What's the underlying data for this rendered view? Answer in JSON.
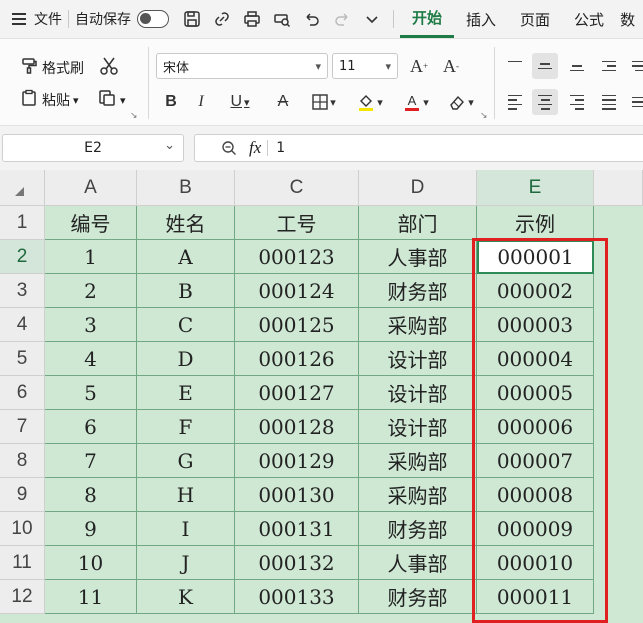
{
  "menubar": {
    "file_label": "文件",
    "autosave_label": "自动保存",
    "tabs": [
      "开始",
      "插入",
      "页面",
      "公式"
    ],
    "partial_tab": "数"
  },
  "ribbon": {
    "format_painter_label": "格式刷",
    "paste_label": "粘贴",
    "font_name": "宋体",
    "font_size": "11"
  },
  "formula_bar": {
    "cell_ref": "E2",
    "fx_label": "fx",
    "value": "1"
  },
  "sheet": {
    "columns": [
      "A",
      "B",
      "C",
      "D",
      "E"
    ],
    "rows": [
      "1",
      "2",
      "3",
      "4",
      "5",
      "6",
      "7",
      "8",
      "9",
      "10",
      "11",
      "12"
    ],
    "active_cell": "E2",
    "table": [
      [
        "编号",
        "姓名",
        "工号",
        "部门",
        "示例"
      ],
      [
        "1",
        "A",
        "000123",
        "人事部",
        "000001"
      ],
      [
        "2",
        "B",
        "000124",
        "财务部",
        "000002"
      ],
      [
        "3",
        "C",
        "000125",
        "采购部",
        "000003"
      ],
      [
        "4",
        "D",
        "000126",
        "设计部",
        "000004"
      ],
      [
        "5",
        "E",
        "000127",
        "设计部",
        "000005"
      ],
      [
        "6",
        "F",
        "000128",
        "设计部",
        "000006"
      ],
      [
        "7",
        "G",
        "000129",
        "采购部",
        "000007"
      ],
      [
        "8",
        "H",
        "000130",
        "采购部",
        "000008"
      ],
      [
        "9",
        "I",
        "000131",
        "财务部",
        "000009"
      ],
      [
        "10",
        "J",
        "000132",
        "人事部",
        "000010"
      ],
      [
        "11",
        "K",
        "000133",
        "财务部",
        "000011"
      ]
    ]
  },
  "colors": {
    "accent": "#1e7b45",
    "cell_fill": "#cfe8d4",
    "highlight_box": "#e02020"
  }
}
